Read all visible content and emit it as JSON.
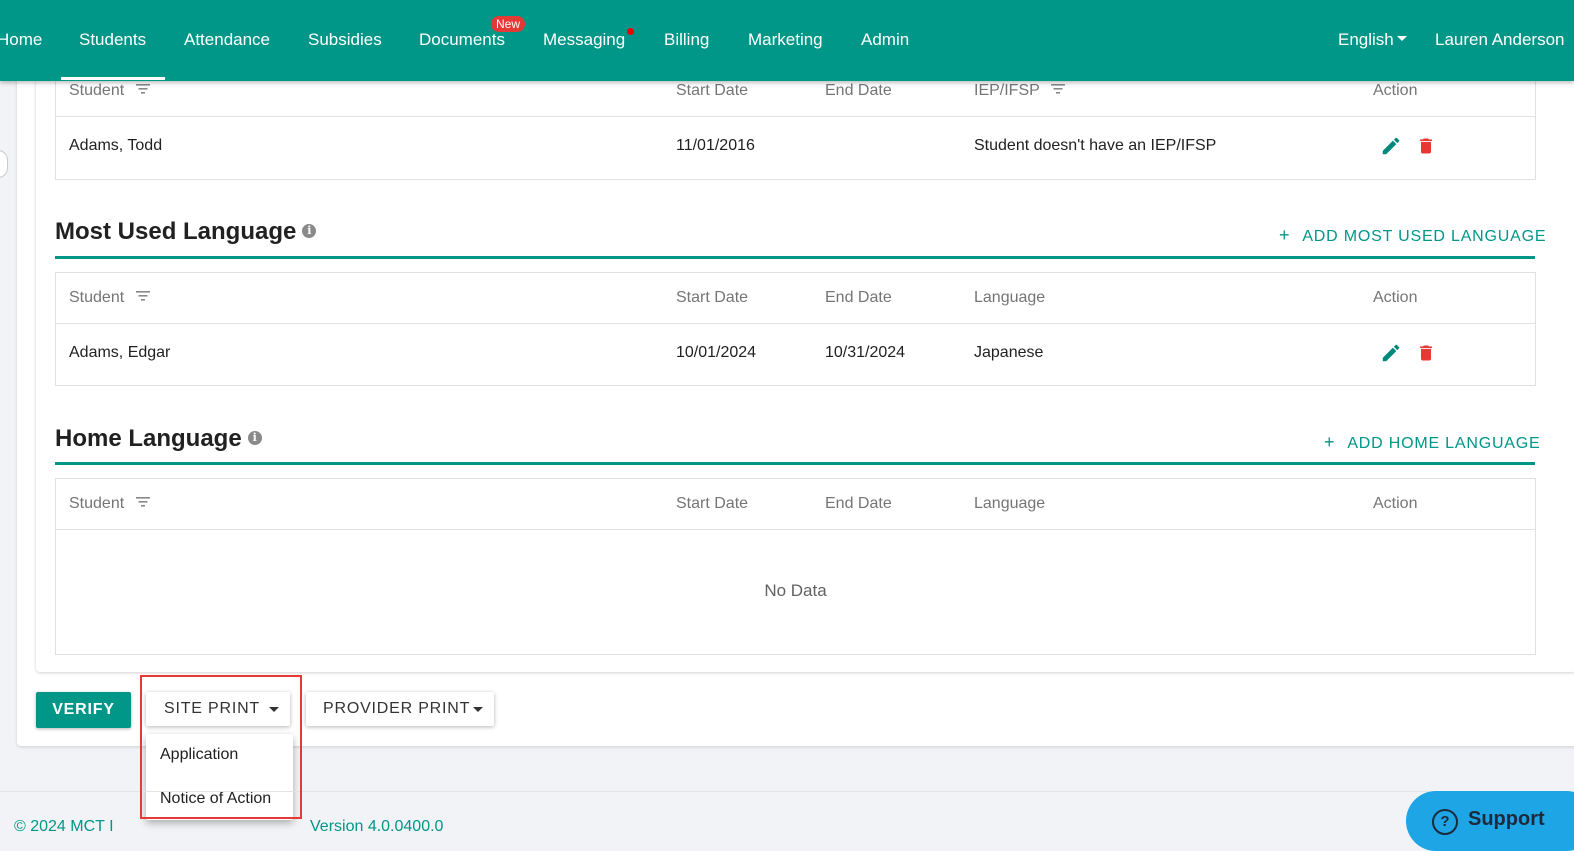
{
  "nav": {
    "items": [
      {
        "label": "Home"
      },
      {
        "label": "Students"
      },
      {
        "label": "Attendance"
      },
      {
        "label": "Subsidies"
      },
      {
        "label": "Documents"
      },
      {
        "label": "Messaging"
      },
      {
        "label": "Billing"
      },
      {
        "label": "Marketing"
      },
      {
        "label": "Admin"
      }
    ],
    "active": "Students",
    "documents_badge": "New",
    "language": "English",
    "user": "Lauren Anderson"
  },
  "iep_table": {
    "headers": {
      "student": "Student",
      "start": "Start Date",
      "end": "End Date",
      "iep": "IEP/IFSP",
      "action": "Action"
    },
    "rows": [
      {
        "student": "Adams, Todd",
        "start": "11/01/2016",
        "end": "",
        "iep": "Student doesn't have an IEP/IFSP"
      }
    ]
  },
  "most_used_language": {
    "title": "Most Used Language",
    "add_label": "ADD MOST USED LANGUAGE",
    "headers": {
      "student": "Student",
      "start": "Start Date",
      "end": "End Date",
      "language": "Language",
      "action": "Action"
    },
    "rows": [
      {
        "student": "Adams, Edgar",
        "start": "10/01/2024",
        "end": "10/31/2024",
        "language": "Japanese"
      }
    ]
  },
  "home_language": {
    "title": "Home Language",
    "add_label": "ADD HOME LANGUAGE",
    "headers": {
      "student": "Student",
      "start": "Start Date",
      "end": "End Date",
      "language": "Language",
      "action": "Action"
    },
    "empty_text": "No Data"
  },
  "actions": {
    "verify": "VERIFY",
    "site_print": "SITE PRINT",
    "provider_print": "PROVIDER PRINT",
    "site_print_menu": [
      "Application",
      "Notice of Action"
    ]
  },
  "footer": {
    "copyright": "© 2024 MCT I",
    "version": "Version 4.0.0400.0"
  },
  "support": {
    "label": "Support"
  },
  "colors": {
    "primary": "#009688",
    "delete": "#e53935",
    "highlight": "#e53935",
    "support": "#1ea5e6"
  }
}
